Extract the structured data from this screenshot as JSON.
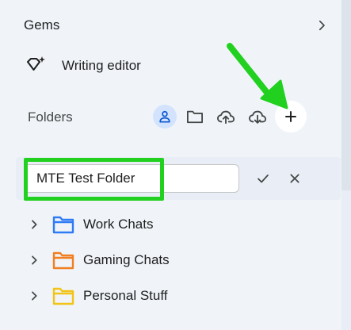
{
  "gems": {
    "title": "Gems",
    "items": [
      {
        "label": "Writing editor",
        "icon": "gem-sparkle-icon"
      }
    ]
  },
  "folders": {
    "title": "Folders",
    "toolbar": [
      {
        "icon": "person-icon",
        "active": true
      },
      {
        "icon": "folder-icon",
        "active": false
      },
      {
        "icon": "cloud-upload-icon",
        "active": false
      },
      {
        "icon": "cloud-download-icon",
        "active": false
      },
      {
        "icon": "plus-icon",
        "active": false
      }
    ],
    "new_folder": {
      "value": "MTE Test Folder",
      "placeholder": ""
    },
    "items": [
      {
        "label": "Work Chats",
        "color": "#2f7bf5"
      },
      {
        "label": "Gaming Chats",
        "color": "#f07f22"
      },
      {
        "label": "Personal Stuff",
        "color": "#f2c418"
      }
    ]
  },
  "colors": {
    "background": "#f0f4f9",
    "annotation": "#22d11f",
    "active_chip": "#d3e3fd"
  }
}
